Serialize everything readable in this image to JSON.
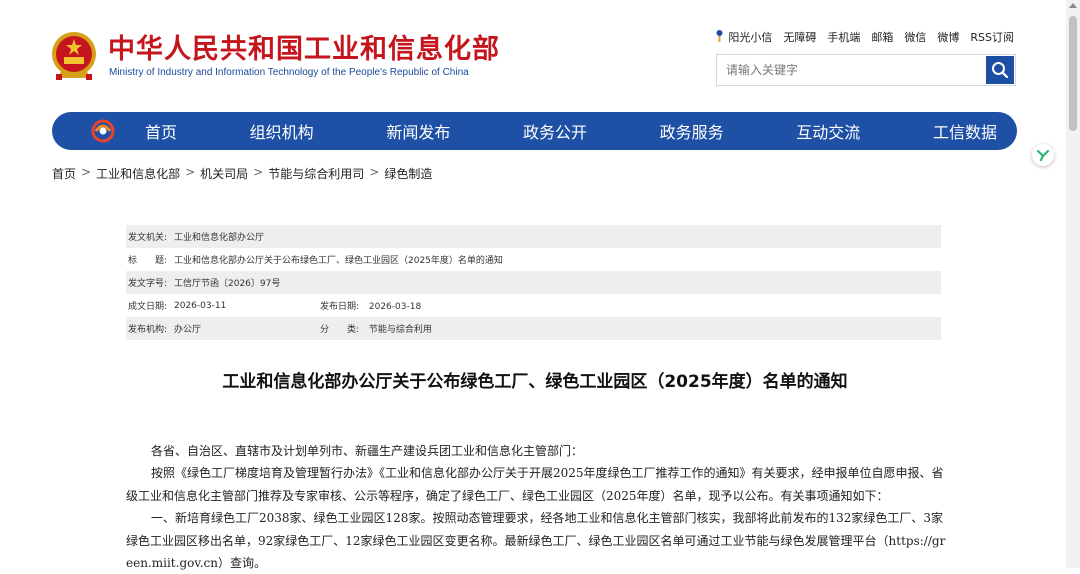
{
  "header": {
    "title_cn": "中华人民共和国工业和信息化部",
    "title_en": "Ministry of Industry and Information Technology of the People's Republic of China"
  },
  "toplinks": [
    "阳光小信",
    "无障碍",
    "手机端",
    "邮箱",
    "微信",
    "微博",
    "RSS订阅"
  ],
  "search": {
    "placeholder": "请输入关键字"
  },
  "nav": [
    "首页",
    "组织机构",
    "新闻发布",
    "政务公开",
    "政务服务",
    "互动交流",
    "工信数据"
  ],
  "breadcrumb": [
    "首页",
    "工业和信息化部",
    "机关司局",
    "节能与综合利用司",
    "绿色制造"
  ],
  "info": {
    "issuer_label": "发文机关:",
    "issuer": "工业和信息化部办公厅",
    "title_label": "标　　题:",
    "title": "工业和信息化部办公厅关于公布绿色工厂、绿色工业园区（2025年度）名单的通知",
    "docno_label": "发文字号:",
    "docno": "工信厅节函〔2026〕97号",
    "written_label": "成文日期:",
    "written": "2026-03-11",
    "published_label": "发布日期:",
    "published": "2026-03-18",
    "org_label": "发布机构:",
    "org": "办公厅",
    "category_label": "分　　类:",
    "category": "节能与综合利用"
  },
  "doc": {
    "title": "工业和信息化部办公厅关于公布绿色工厂、绿色工业园区（2025年度）名单的通知",
    "salutation": "各省、自治区、直辖市及计划单列市、新疆生产建设兵团工业和信息化主管部门：",
    "para1": "按照《绿色工厂梯度培育及管理暂行办法》《工业和信息化部办公厅关于开展2025年度绿色工厂推荐工作的通知》有关要求，经申报单位自愿申报、省级工业和信息化主管部门推荐及专家审核、公示等程序，确定了绿色工厂、绿色工业园区（2025年度）名单，现予以公布。有关事项通知如下：",
    "para2": "一、新培育绿色工厂2038家、绿色工业园区128家。按照动态管理要求，经各地工业和信息化主管部门核实，我部将此前发布的132家绿色工厂、3家绿色工业园区移出名单，92家绿色工厂、12家绿色工业园区变更名称。最新绿色工厂、绿色工业园区名单可通过工业节能与绿色发展管理平台（https://green.miit.gov.cn）查询。"
  },
  "colors": {
    "brand_red": "#c4161c",
    "nav_blue": "#1e50a5"
  }
}
